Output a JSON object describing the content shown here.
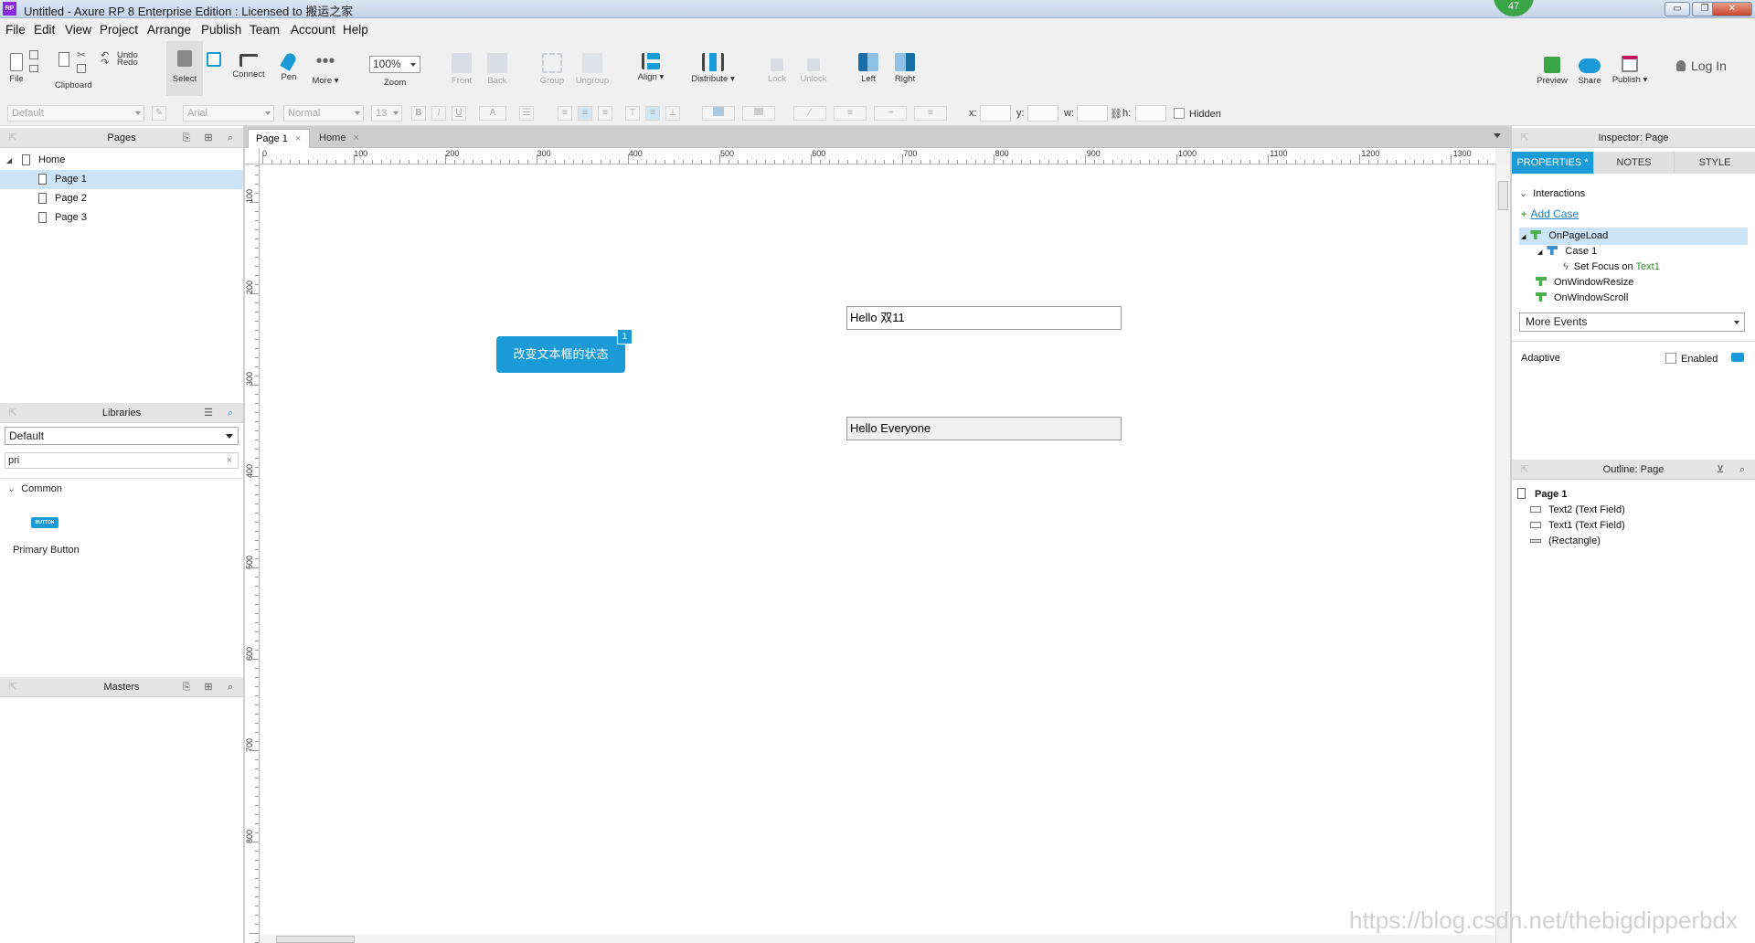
{
  "window": {
    "title": "Untitled - Axure RP 8 Enterprise Edition : Licensed to 搬运之家",
    "app_icon": "RP",
    "badge": "47",
    "buttons": [
      "▭",
      "❐",
      "✕"
    ]
  },
  "menu": [
    "File",
    "Edit",
    "View",
    "Project",
    "Arrange",
    "Publish",
    "Team",
    "Account",
    "Help"
  ],
  "toolbar": {
    "file": "File",
    "clipboard": "Clipboard",
    "undo": "Undo",
    "redo": "Redo",
    "select": "Select",
    "connect": "Connect",
    "pen": "Pen",
    "more": "More ▾",
    "zoom_value": "100%",
    "zoom": "Zoom",
    "front": "Front",
    "back": "Back",
    "group": "Group",
    "ungroup": "Ungroup",
    "align": "Align ▾",
    "distribute": "Distribute ▾",
    "lock": "Lock",
    "unlock": "Unlock",
    "left": "Left",
    "right": "Right",
    "preview": "Preview",
    "share": "Share",
    "publish": "Publish ▾",
    "login": "Log In"
  },
  "format_bar": {
    "style": "Default",
    "font": "Arial",
    "weight": "Normal",
    "size": "13",
    "bold": "B",
    "italic": "I",
    "underline": "U",
    "font_color": "A",
    "x_label": "x:",
    "y_label": "y:",
    "w_label": "w:",
    "h_label": "h:",
    "hidden": "Hidden"
  },
  "pages_panel": {
    "title": "Pages",
    "items": [
      {
        "label": "Home",
        "level": 0,
        "selected": false
      },
      {
        "label": "Page 1",
        "level": 1,
        "selected": true
      },
      {
        "label": "Page 2",
        "level": 1,
        "selected": false
      },
      {
        "label": "Page 3",
        "level": 1,
        "selected": false
      }
    ]
  },
  "libraries_panel": {
    "title": "Libraries",
    "library": "Default",
    "search": "pri",
    "clear": "×",
    "group": "Common",
    "widget_icon_text": "BUTTON",
    "widget_label": "Primary Button"
  },
  "masters_panel": {
    "title": "Masters"
  },
  "tabs": [
    {
      "label": "Page 1",
      "close": "×",
      "active": true
    },
    {
      "label": "Home",
      "close": "×",
      "active": false
    }
  ],
  "ruler": {
    "h": [
      "0",
      "100",
      "200",
      "300",
      "400",
      "500",
      "600",
      "700",
      "800",
      "900",
      "1000",
      "1100",
      "1200",
      "1300"
    ],
    "v": [
      "100",
      "200",
      "300",
      "400",
      "500",
      "600",
      "700",
      "800"
    ]
  },
  "canvas": {
    "button_label": "改变文本框的状态",
    "button_badge": "1",
    "text2_value": "Hello 双11",
    "text1_value": "Hello Everyone"
  },
  "inspector": {
    "title": "Inspector: Page",
    "tabs": [
      "PROPERTIES *",
      "NOTES",
      "STYLE"
    ],
    "interactions": "Interactions",
    "add_case": "Add Case",
    "on_page_load": "OnPageLoad",
    "case1": "Case 1",
    "action_prefix": "Set Focus on",
    "action_target": "Text1",
    "on_window_resize": "OnWindowResize",
    "on_window_scroll": "OnWindowScroll",
    "more_events": "More Events",
    "adaptive": "Adaptive",
    "enabled": "Enabled"
  },
  "outline": {
    "title": "Outline: Page",
    "root": "Page 1",
    "items": [
      "Text2 (Text Field)",
      "Text1 (Text Field)",
      "(Rectangle)"
    ]
  },
  "watermark": "https://blog.csdn.net/thebigdipperbdx",
  "colors": {
    "accent": "#1a9ad6",
    "interaction_green": "#4caf50",
    "selection": "#cce4f7"
  }
}
